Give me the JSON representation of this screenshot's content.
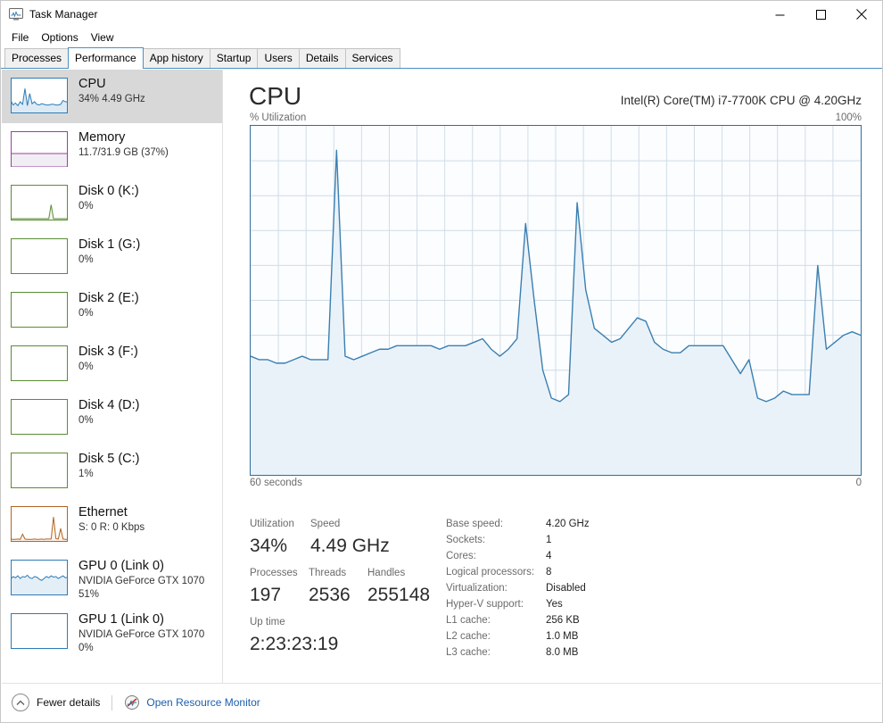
{
  "window": {
    "title": "Task Manager",
    "icon": "task-manager-icon",
    "minimize_label": "Minimize",
    "maximize_label": "Maximize",
    "close_label": "Close"
  },
  "menubar": {
    "items": [
      {
        "label": "File"
      },
      {
        "label": "Options"
      },
      {
        "label": "View"
      }
    ]
  },
  "tabs": [
    {
      "label": "Processes",
      "active": false
    },
    {
      "label": "Performance",
      "active": true
    },
    {
      "label": "App history",
      "active": false
    },
    {
      "label": "Startup",
      "active": false
    },
    {
      "label": "Users",
      "active": false
    },
    {
      "label": "Details",
      "active": false
    },
    {
      "label": "Services",
      "active": false
    }
  ],
  "sidebar": {
    "items": [
      {
        "name": "cpu",
        "title": "CPU",
        "sub": "34%  4.49 GHz",
        "sub2": "",
        "selected": true,
        "color": "#2e7bb5",
        "fill": "#ddeaf5"
      },
      {
        "name": "memory",
        "title": "Memory",
        "sub": "11.7/31.9 GB (37%)",
        "sub2": "",
        "selected": false,
        "color": "#9b3fa0",
        "fill": "#f0eef2"
      },
      {
        "name": "disk-0",
        "title": "Disk 0 (K:)",
        "sub": "0%",
        "sub2": "",
        "selected": false,
        "color": "#5a8c36",
        "fill": "#f3f7ef"
      },
      {
        "name": "disk-1",
        "title": "Disk 1 (G:)",
        "sub": "0%",
        "sub2": "",
        "selected": false,
        "color": "#5a8c36",
        "fill": "#f3f7ef"
      },
      {
        "name": "disk-2",
        "title": "Disk 2 (E:)",
        "sub": "0%",
        "sub2": "",
        "selected": false,
        "color": "#5a8c36",
        "fill": "#f3f7ef"
      },
      {
        "name": "disk-3",
        "title": "Disk 3 (F:)",
        "sub": "0%",
        "sub2": "",
        "selected": false,
        "color": "#5a8c36",
        "fill": "#f3f7ef"
      },
      {
        "name": "disk-4",
        "title": "Disk 4 (D:)",
        "sub": "0%",
        "sub2": "",
        "selected": false,
        "color": "#5a8c36",
        "fill": "#f3f7ef"
      },
      {
        "name": "disk-5",
        "title": "Disk 5 (C:)",
        "sub": "1%",
        "sub2": "",
        "selected": false,
        "color": "#5a8c36",
        "fill": "#f3f7ef"
      },
      {
        "name": "ethernet",
        "title": "Ethernet",
        "sub": "S: 0  R: 0 Kbps",
        "sub2": "",
        "selected": false,
        "color": "#b06522",
        "fill": "#faf2ea"
      },
      {
        "name": "gpu-0",
        "title": "GPU 0 (Link 0)",
        "sub": "NVIDIA GeForce GTX 1070",
        "sub2": "51%",
        "selected": false,
        "color": "#2e7bb5",
        "fill": "#e3eef7"
      },
      {
        "name": "gpu-1",
        "title": "GPU 1 (Link 0)",
        "sub": "NVIDIA GeForce GTX 1070",
        "sub2": "0%",
        "selected": false,
        "color": "#2e7bb5",
        "fill": "#eef5fb"
      }
    ]
  },
  "main": {
    "title": "CPU",
    "model": "Intel(R) Core(TM) i7-7700K CPU @ 4.20GHz",
    "graph_axis_label": "% Utilization",
    "graph_max_label": "100%",
    "graph_time_label": "60 seconds",
    "graph_time_zero": "0"
  },
  "stats": {
    "utilization": {
      "label": "Utilization",
      "value": "34%"
    },
    "speed": {
      "label": "Speed",
      "value": "4.49 GHz"
    },
    "processes": {
      "label": "Processes",
      "value": "197"
    },
    "threads": {
      "label": "Threads",
      "value": "2536"
    },
    "handles": {
      "label": "Handles",
      "value": "255148"
    },
    "uptime": {
      "label": "Up time",
      "value": "2:23:23:19"
    }
  },
  "specs": [
    {
      "label": "Base speed:",
      "value": "4.20 GHz"
    },
    {
      "label": "Sockets:",
      "value": "1"
    },
    {
      "label": "Cores:",
      "value": "4"
    },
    {
      "label": "Logical processors:",
      "value": "8"
    },
    {
      "label": "Virtualization:",
      "value": "Disabled"
    },
    {
      "label": "Hyper-V support:",
      "value": "Yes"
    },
    {
      "label": "L1 cache:",
      "value": "256 KB"
    },
    {
      "label": "L2 cache:",
      "value": "1.0 MB"
    },
    {
      "label": "L3 cache:",
      "value": "8.0 MB"
    }
  ],
  "statusbar": {
    "fewer_details": "Fewer details",
    "open_resource_monitor": "Open Resource Monitor"
  },
  "colors": {
    "accent": "#2e6e9e",
    "line": "#3a7fb0",
    "area": "#eaf2f9",
    "grid": "#cfdce6",
    "link": "#1c5fad",
    "selected_row": "#d8d8d8"
  },
  "chart_data": {
    "type": "area",
    "title": "% Utilization",
    "xlabel": "60 seconds",
    "ylabel": "% Utilization",
    "ylim": [
      0,
      100
    ],
    "xlim": [
      60,
      0
    ],
    "grid": true,
    "legend": null,
    "annotations": [
      "60 seconds",
      "0",
      "100%",
      "% Utilization"
    ],
    "series": [
      {
        "name": "CPU utilization",
        "color": "#3a7fb0",
        "values": [
          34,
          33,
          33,
          32,
          32,
          33,
          34,
          33,
          33,
          33,
          93,
          34,
          33,
          34,
          35,
          36,
          36,
          37,
          37,
          37,
          37,
          37,
          36,
          37,
          37,
          37,
          38,
          39,
          36,
          34,
          36,
          39,
          72,
          50,
          30,
          22,
          21,
          23,
          78,
          53,
          42,
          40,
          38,
          39,
          42,
          45,
          44,
          38,
          36,
          35,
          35,
          37,
          37,
          37,
          37,
          37,
          33,
          29,
          33,
          22,
          21,
          22,
          24,
          23,
          23,
          23,
          60,
          36,
          38,
          40,
          41,
          40
        ]
      }
    ]
  }
}
